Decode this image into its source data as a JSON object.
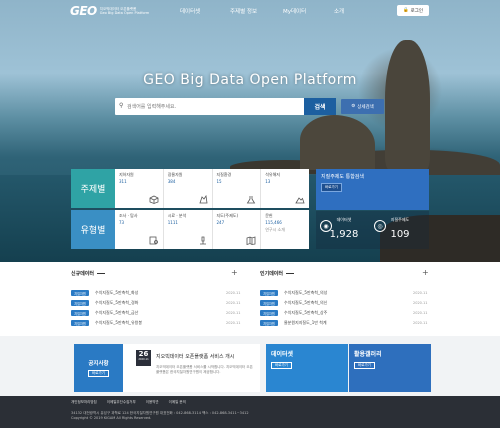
{
  "nav": {
    "logo_mark": "GEO",
    "logo_line1": "지오빅데이터 오픈플랫폼",
    "logo_line2": "Geo Big Data Open Platform",
    "menu": [
      "데이터셋",
      "주제별 정보",
      "My데이터",
      "소개"
    ],
    "login": "로그인"
  },
  "hero": {
    "title": "GEO Big Data Open Platform",
    "search_placeholder": "검색어를 입력해주세요.",
    "search_button": "검색",
    "advanced_button": "상세검색"
  },
  "topic": {
    "label": "주제별",
    "items": [
      {
        "name": "지하자원",
        "count": "311"
      },
      {
        "name": "광물자원",
        "count": "384"
      },
      {
        "name": "지질환경",
        "count": "15"
      },
      {
        "name": "석유해저",
        "count": "13"
      }
    ]
  },
  "type": {
    "label": "유형별",
    "items": [
      {
        "name": "조사 · 탐사",
        "count": "73"
      },
      {
        "name": "시료 · 분석",
        "count": "1111"
      },
      {
        "name": "지도(주제도)",
        "count": "247"
      },
      {
        "name": "문헌",
        "count": "115,466"
      }
    ],
    "overlay": "연구시 소개"
  },
  "system": {
    "title": "지질주제도 통합검색",
    "button": "바로가기"
  },
  "stats": [
    {
      "label": "데이터셋",
      "value": "1,928"
    },
    {
      "label": "지질주제도",
      "value": "109"
    }
  ],
  "latest": {
    "title": "신규데이터",
    "rows": [
      {
        "tag": "지질자원",
        "text": "수치지질도_5만축척_화성",
        "date": "2020.11"
      },
      {
        "tag": "지질자원",
        "text": "수치지질도_5만축척_경화",
        "date": "2020.11"
      },
      {
        "tag": "지질자원",
        "text": "수치지질도_5만축척_금산",
        "date": "2020.11"
      },
      {
        "tag": "지질자원",
        "text": "수치지질도_5만축척_유왕봉",
        "date": "2020.11"
      }
    ]
  },
  "popular": {
    "title": "인기데이터",
    "rows": [
      {
        "tag": "지질자원",
        "text": "수치지질도_5만축척_의성",
        "date": "2020.11"
      },
      {
        "tag": "지질자원",
        "text": "수치지질도_5만축척_의신",
        "date": "2020.11"
      },
      {
        "tag": "지질자원",
        "text": "수치지질도_5만축척_상주",
        "date": "2020.11"
      },
      {
        "tag": "지질자원",
        "text": "물분원지지질도_1만 척계",
        "date": "2020.11"
      }
    ]
  },
  "notice": {
    "title": "공지사항",
    "button": "바로가기",
    "day": "26",
    "month": "2020.11",
    "headline": "지오빅데이터 오픈플랫폼 서비스 개시",
    "body": "지오빅데이터 오픈플랫폼 서비스를 시작합니다. 지오빅데이터 오픈플랫폼은 한국지질자원연구원이 제공합니다."
  },
  "quick": [
    {
      "title": "데이터셋",
      "button": "바로가기",
      "color": "#2a86d1"
    },
    {
      "title": "활용갤러리",
      "button": "바로가기",
      "color": "#2e6fbd"
    }
  ],
  "footer": {
    "links": [
      "개인정보처리방침",
      "이메일무단수집거부",
      "이용약관",
      "이메일 문의"
    ],
    "address": "34132 대전광역시 유성구 과학로 124 한국지질자원연구원 대표전화 : 042-868-3114 팩스 : 042-868-3411~3412",
    "copyright": "Copyright © 2019 KIGAM All Rights Reserved."
  }
}
